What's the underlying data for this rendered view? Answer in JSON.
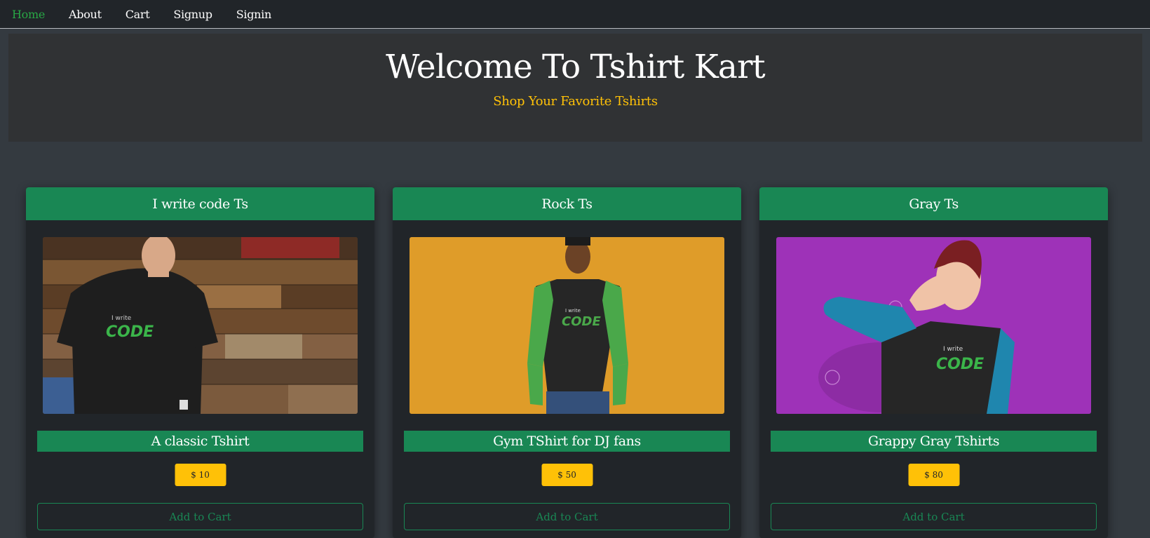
{
  "nav": {
    "items": [
      {
        "label": "Home",
        "active": true
      },
      {
        "label": "About",
        "active": false
      },
      {
        "label": "Cart",
        "active": false
      },
      {
        "label": "Signup",
        "active": false
      },
      {
        "label": "Signin",
        "active": false
      }
    ]
  },
  "hero": {
    "title": "Welcome To Tshirt Kart",
    "subtitle": "Shop Your Favorite Tshirts"
  },
  "products": [
    {
      "header": "I write code Ts",
      "title": "A classic Tshirt",
      "price": "$ 10",
      "cart_label": "Add to Cart",
      "image": "man-black-tshirt-wood-wall"
    },
    {
      "header": "Rock Ts",
      "title": "Gym TShirt for DJ fans",
      "price": "$ 50",
      "cart_label": "Add to Cart",
      "image": "man-raglan-tshirt-yellow-wall"
    },
    {
      "header": "Gray Ts",
      "title": "Grappy Gray Tshirts",
      "price": "$ 80",
      "cart_label": "Add to Cart",
      "image": "woman-raglan-tshirt-purple-wall"
    }
  ],
  "colors": {
    "accent": "#198754",
    "nav_active": "#28a745",
    "subtitle": "#ffc107",
    "price": "#ffc107"
  }
}
